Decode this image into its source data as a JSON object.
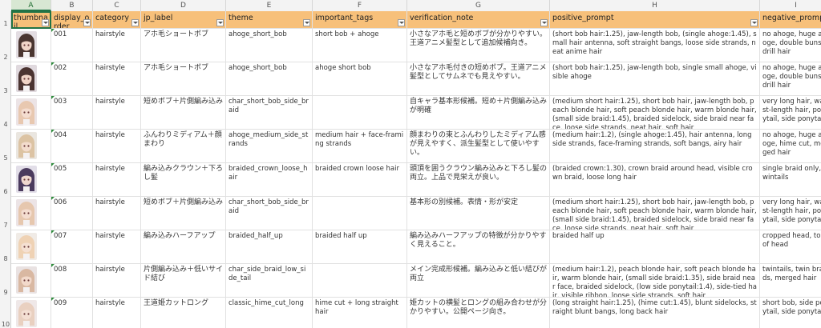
{
  "column_letters": [
    "A",
    "B",
    "C",
    "D",
    "E",
    "F",
    "G",
    "H",
    "I"
  ],
  "row_numbers": [
    "1",
    "2",
    "3",
    "4",
    "5",
    "6",
    "7",
    "8",
    "9",
    "10"
  ],
  "headers": [
    "thumbnail",
    "display_order",
    "category",
    "jp_label",
    "theme",
    "important_tags",
    "verification_note",
    "positive_prompt",
    "negative_prompt"
  ],
  "rows": [
    {
      "order": "001",
      "category": "hairstyle",
      "jp_label": "アホ毛ショートボブ",
      "theme": "ahoge_short_bob",
      "tags": "short bob + ahoge",
      "note": "小さなアホ毛と短めボブが分かりやすい。王道アニメ髪型として追加候補向き。",
      "positive": "(short bob hair:1.25), jaw-length bob, (single ahoge:1.45), small hair antenna, soft straight bangs, loose side strands, neat anime hair",
      "negative": "no ahoge, huge ahoge, double buns, drill hair",
      "hair": "#4a3530",
      "skin": "#f1d5c8",
      "bg": "#d9cfd6"
    },
    {
      "order": "002",
      "category": "hairstyle",
      "jp_label": "アホ毛ショートボブ",
      "theme": "ahoge_short_bob",
      "tags": "ahoge short bob",
      "note": "小さなアホ毛付きの短めボブ。王道アニメ髪型としてサムネでも見えやすい。",
      "positive": "(short bob hair:1.25), jaw-length bob, single small ahoge, visible ahoge",
      "negative": "no ahoge, huge ahoge, double buns, drill hair",
      "hair": "#4b3431",
      "skin": "#efd3c6",
      "bg": "#d6ccd3"
    },
    {
      "order": "003",
      "category": "hairstyle",
      "jp_label": "短めボブ＋片側編み込み",
      "theme": "char_short_bob_side_braid",
      "tags": "",
      "note": "自キャラ基本形候補。短め＋片側編み込みが明確",
      "positive": "(medium short hair:1.25), short bob hair, jaw-length bob, peach blonde hair, soft peach blonde hair, warm blonde hair, (small side braid:1.45), braided sidelock, side braid near face, loose side strands, neat hair, soft hair",
      "negative": "very long hair, waist-length hair, ponytail, side ponytail"
    },
    {
      "order": "004",
      "category": "hairstyle",
      "jp_label": "ふんわりミディアム＋顔まわり",
      "theme": "ahoge_medium_side_strands",
      "tags": "medium hair + face-framing strands",
      "note": "顔まわりの束とふんわりしたミディアム感が見えやすく、派生髪型として使いやすい。",
      "positive": "(medium hair:1.2), (single ahoge:1.45), hair antenna, long side strands, face-framing strands, soft bangs, airy hair",
      "negative": "no ahoge, huge ahoge, hime cut, merged hair"
    },
    {
      "order": "005",
      "category": "hairstyle",
      "jp_label": "編み込みクラウン＋下ろし髪",
      "theme": "braided_crown_loose_hair",
      "tags": "braided crown loose hair",
      "note": "頭頂を囲うクラウン編み込みと下ろし髪の両立。上品で見栄えが良い。",
      "positive": "(braided crown:1.30), crown braid around head, visible crown braid, loose long hair",
      "negative": "single braid only, twintails"
    },
    {
      "order": "006",
      "category": "hairstyle",
      "jp_label": "短めボブ＋片側編み込み",
      "theme": "char_short_bob_side_braid",
      "tags": "",
      "note": "基本形の別候補。表情・形が安定",
      "positive": "(medium short hair:1.25), short bob hair, jaw-length bob, peach blonde hair, soft peach blonde hair, warm blonde hair, (small side braid:1.45), braided sidelock, side braid near face, loose side strands, neat hair, soft hair",
      "negative": "very long hair, waist-length hair, ponytail, side ponytail"
    },
    {
      "order": "007",
      "category": "hairstyle",
      "jp_label": "編み込みハーフアップ",
      "theme": "braided_half_up",
      "tags": "braided half up",
      "note": "編み込みハーフアップの特徴が分かりやすく見えること。",
      "positive": "braided half up",
      "negative": "cropped head, top of head"
    },
    {
      "order": "008",
      "category": "hairstyle",
      "jp_label": "片側編み込み＋低いサイド結び",
      "theme": "char_side_braid_low_side_tail",
      "tags": "",
      "note": "メイン完成形候補。編み込みと低い結びが両立",
      "positive": "(medium hair:1.2), peach blonde hair, soft peach blonde hair, warm blonde hair, (small side braid:1.35), side braid near face, braided sidelock, (low side ponytail:1.4), side-tied hair, visible ribbon, loose side strands, soft hair",
      "negative": "twintails, twin braids, merged hair"
    },
    {
      "order": "009",
      "category": "hairstyle",
      "jp_label": "王道姫カットロング",
      "theme": "classic_hime_cut_long",
      "tags": "hime cut + long straight hair",
      "note": "姫カットの横髪とロングの組み合わせが分かりやすい。公開ページ向き。",
      "positive": "(long straight hair:1.25), (hime cut:1.45), blunt sidelocks, straight blunt bangs, long back hair",
      "negative": "short bob, side ponytail, side ponytail"
    }
  ],
  "thumb_colors": [
    {
      "hair": "#4a3530",
      "skin": "#f1d5c8",
      "bg": "#e3dde2"
    },
    {
      "hair": "#4b3431",
      "skin": "#efd3c6",
      "bg": "#e0d9de"
    },
    {
      "hair": "#e8c8b0",
      "skin": "#f4ddd0",
      "bg": "#ece4e6"
    },
    {
      "hair": "#dcc3a3",
      "skin": "#f3dccd",
      "bg": "#eae6e0"
    },
    {
      "hair": "#4b3b5e",
      "skin": "#f0d8cf",
      "bg": "#e2dee8"
    },
    {
      "hair": "#e6c7ae",
      "skin": "#f4ddd0",
      "bg": "#ece4e6"
    },
    {
      "hair": "#efd2b4",
      "skin": "#f5e0d2",
      "bg": "#f0ebe6"
    },
    {
      "hair": "#d9b8a2",
      "skin": "#f2d9cb",
      "bg": "#e9e2e2"
    },
    {
      "hair": "#e9d0c0",
      "skin": "#f4dfd3",
      "bg": "#efe8e8"
    }
  ],
  "colors": {
    "header_fill": "#f7c07a",
    "selected_column": "#217346"
  }
}
